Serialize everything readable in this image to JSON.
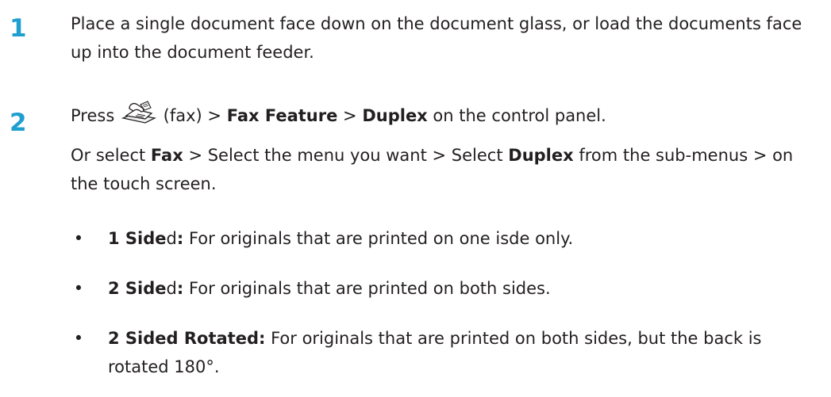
{
  "steps": [
    {
      "number": "1",
      "text": "Place a single document face down on the document glass, or load the documents face up into the document feeder."
    },
    {
      "number": "2",
      "line1": {
        "press": "Press",
        "icon": "fax-icon",
        "fax_label": "(fax) >",
        "fax_feature": "Fax Feature",
        "sep": ">",
        "duplex": "Duplex",
        "tail": "on the control panel."
      },
      "line2": {
        "or_select": "Or select",
        "fax": "Fax",
        "middle": "> Select the menu you want > Select",
        "duplex": "Duplex",
        "tail": "from the sub-menus > on the touch screen."
      }
    }
  ],
  "bullets": [
    {
      "bold": "1 Side",
      "rest_normal": "d",
      "bold_colon": ":",
      "desc": "For originals that are printed on one isde only."
    },
    {
      "bold": "2 Side",
      "rest_normal": "d",
      "bold_colon": ":",
      "desc": "For originals that are printed on both sides."
    },
    {
      "bold": "2 Sided Rotated:",
      "rest_normal": "",
      "bold_colon": "",
      "desc": "For originals that are printed on both sides, but the back is rotated 180°."
    }
  ],
  "bullet_symbol": "•",
  "colors": {
    "step_number": "#1f9fd0",
    "text": "#231f20"
  }
}
